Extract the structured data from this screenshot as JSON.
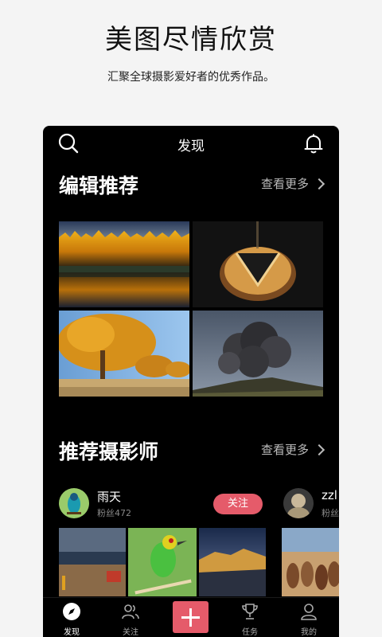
{
  "promo": {
    "headline": "美图尽情欣赏",
    "subline": "汇聚全球摄影爱好者的优秀作品。"
  },
  "topbar": {
    "title": "发现",
    "search_icon": "search-icon",
    "bell_icon": "bell-icon"
  },
  "editor_picks": {
    "title": "编辑推荐",
    "more_label": "查看更多"
  },
  "photographers": {
    "title": "推荐摄影师",
    "more_label": "查看更多",
    "items": [
      {
        "name": "雨天",
        "fans": "粉丝472",
        "follow_label": "关注"
      },
      {
        "name": "zzl",
        "fans": "粉丝"
      }
    ]
  },
  "tabbar": {
    "items": [
      {
        "label": "发现",
        "icon": "compass-icon",
        "active": true
      },
      {
        "label": "关注",
        "icon": "people-icon",
        "active": false
      },
      {
        "label": "",
        "icon": "plus-icon",
        "active": false
      },
      {
        "label": "任务",
        "icon": "trophy-icon",
        "active": false
      },
      {
        "label": "我的",
        "icon": "person-icon",
        "active": false
      }
    ]
  },
  "colors": {
    "accent": "#e55b6a",
    "background": "#000000",
    "page_background": "#f4f4f4"
  }
}
